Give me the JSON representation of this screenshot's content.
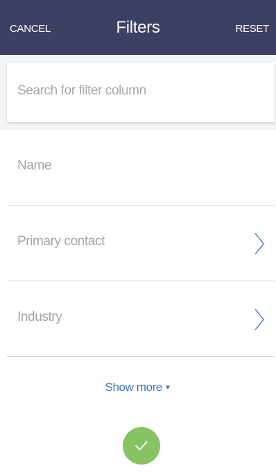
{
  "header": {
    "cancel_label": "CANCEL",
    "title": "Filters",
    "reset_label": "RESET",
    "background_color": "#3d3f63"
  },
  "search": {
    "placeholder": "Search for filter column",
    "value": ""
  },
  "filters": [
    {
      "label": "Name",
      "icon": null
    },
    {
      "label": "Primary contact",
      "icon": "chevron-right-icon"
    },
    {
      "label": "Industry",
      "icon": "chevron-right-icon"
    }
  ],
  "show_more": {
    "label": "Show more",
    "icon": "caret-down-icon",
    "color": "#3a78c9"
  },
  "confirm_button": {
    "icon": "checkmark-icon",
    "color": "#86c463"
  }
}
